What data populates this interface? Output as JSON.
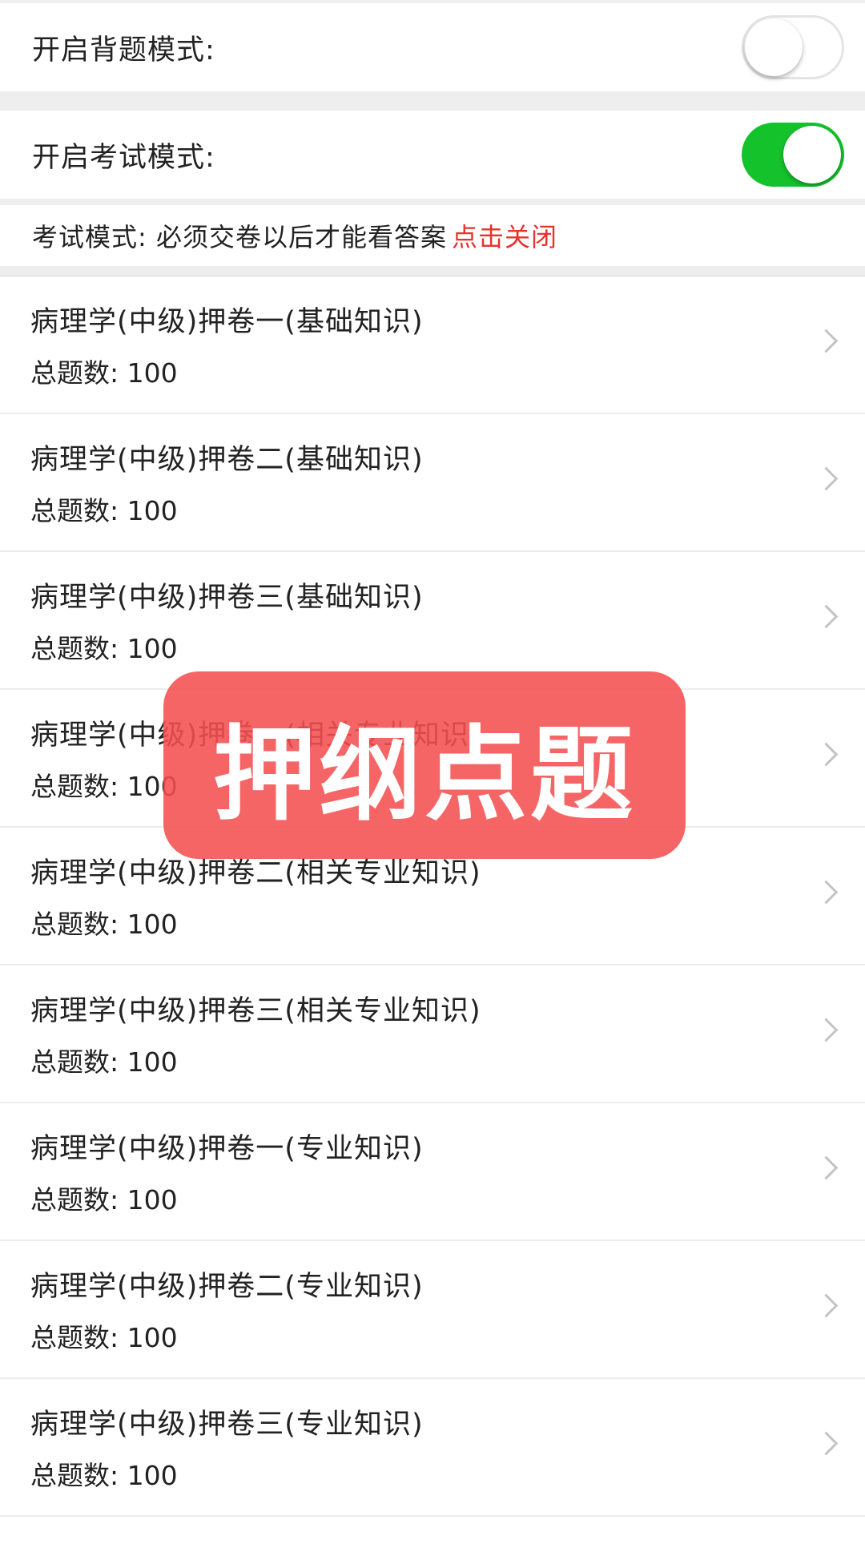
{
  "settings": {
    "recite_mode_label": "开启背题模式:",
    "recite_mode_on": false,
    "exam_mode_label": "开启考试模式:",
    "exam_mode_on": true,
    "switch_on_color": "#14c22c"
  },
  "notice": {
    "text": "考试模式: 必须交卷以后才能看答案",
    "link": "点击关闭",
    "link_color": "#e8322d"
  },
  "papers": [
    {
      "title": "病理学(中级)押卷一(基础知识)",
      "count": "总题数: 100"
    },
    {
      "title": "病理学(中级)押卷二(基础知识)",
      "count": "总题数: 100"
    },
    {
      "title": "病理学(中级)押卷三(基础知识)",
      "count": "总题数: 100"
    },
    {
      "title": "病理学(中级)押卷一(相关专业知识)",
      "count": "总题数: 100"
    },
    {
      "title": "病理学(中级)押卷二(相关专业知识)",
      "count": "总题数: 100"
    },
    {
      "title": "病理学(中级)押卷三(相关专业知识)",
      "count": "总题数: 100"
    },
    {
      "title": "病理学(中级)押卷一(专业知识)",
      "count": "总题数: 100"
    },
    {
      "title": "病理学(中级)押卷二(专业知识)",
      "count": "总题数: 100"
    },
    {
      "title": "病理学(中级)押卷三(专业知识)",
      "count": "总题数: 100"
    }
  ],
  "overlay": {
    "text": "押纲点题",
    "color": "#f45050"
  },
  "icons": {
    "row_arrow": "chevron-right-icon"
  }
}
